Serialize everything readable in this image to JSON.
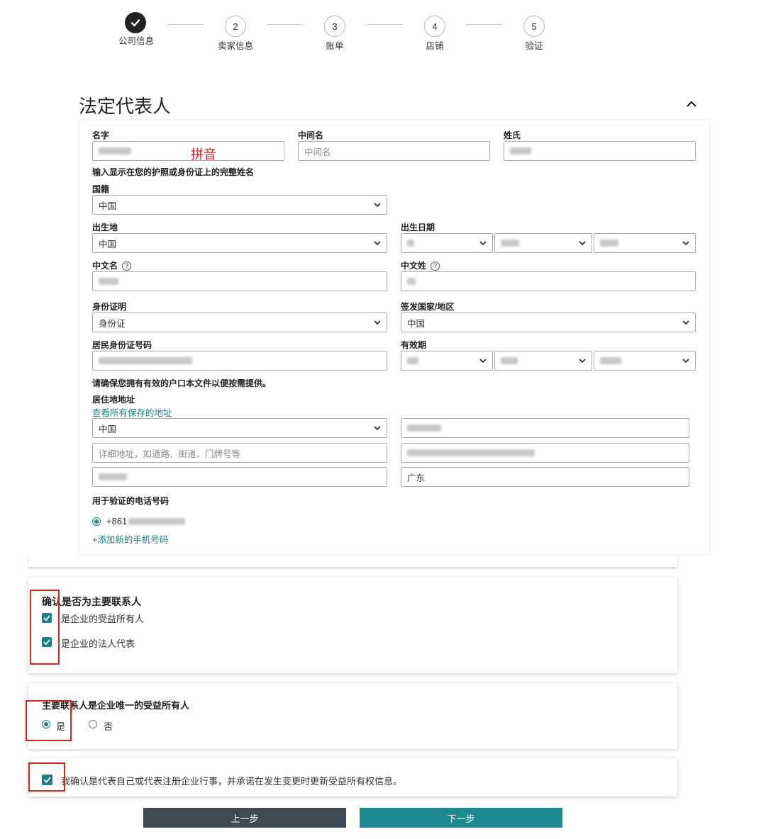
{
  "stepper": {
    "steps": [
      {
        "num": "",
        "label": "公司信息",
        "done": true
      },
      {
        "num": "2",
        "label": "卖家信息"
      },
      {
        "num": "3",
        "label": "账单"
      },
      {
        "num": "4",
        "label": "店铺"
      },
      {
        "num": "5",
        "label": "验证"
      }
    ]
  },
  "section": {
    "title": "法定代表人"
  },
  "form": {
    "first_name_label": "名字",
    "middle_name_label": "中间名",
    "middle_name_placeholder": "中间名",
    "last_name_label": "姓氏",
    "pinyin_annotation": "拼音",
    "full_name_hint": "输入显示在您的护照或身份证上的完整姓名",
    "nationality_label": "国籍",
    "nationality_value": "中国",
    "birthplace_label": "出生地",
    "birthplace_value": "中国",
    "dob_label": "出生日期",
    "cn_first_name_label": "中文名",
    "cn_last_name_label": "中文姓",
    "id_type_label": "身份证明",
    "id_type_value": "身份证",
    "issuing_country_label": "签发国家/地区",
    "issuing_country_value": "中国",
    "id_number_label": "居民身份证号码",
    "expiry_label": "有效期",
    "hukou_note": "请确保您拥有有效的户口本文件以便按需提供。",
    "address_label": "居住地地址",
    "view_addresses_link": "查看所有保存的地址",
    "address_country_value": "中国",
    "address_detail_placeholder": "详细地址，如道路、街道、门牌号等",
    "province_value": "广东",
    "phone_label": "用于验证的电话号码",
    "phone_prefix": "+861",
    "add_phone_link": "+添加新的手机号码"
  },
  "contact": {
    "title": "确认是否为主要联系人",
    "beneficial_owner_label": "是企业的受益所有人",
    "legal_rep_label": "是企业的法人代表"
  },
  "sole_owner": {
    "title": "主要联系人是企业唯一的受益所有人",
    "yes_label": "是",
    "no_label": "否"
  },
  "confirm": {
    "text": "我确认是代表自己或代表注册企业行事，并承诺在发生变更时更新受益所有权信息。"
  },
  "buttons": {
    "prev_label": "上一步",
    "next_label": "下一步"
  },
  "colors": {
    "accent": "#1c7f86",
    "annotation_red": "#e02020",
    "prev_button": "#3f4a55",
    "next_button": "#1c8a90"
  }
}
